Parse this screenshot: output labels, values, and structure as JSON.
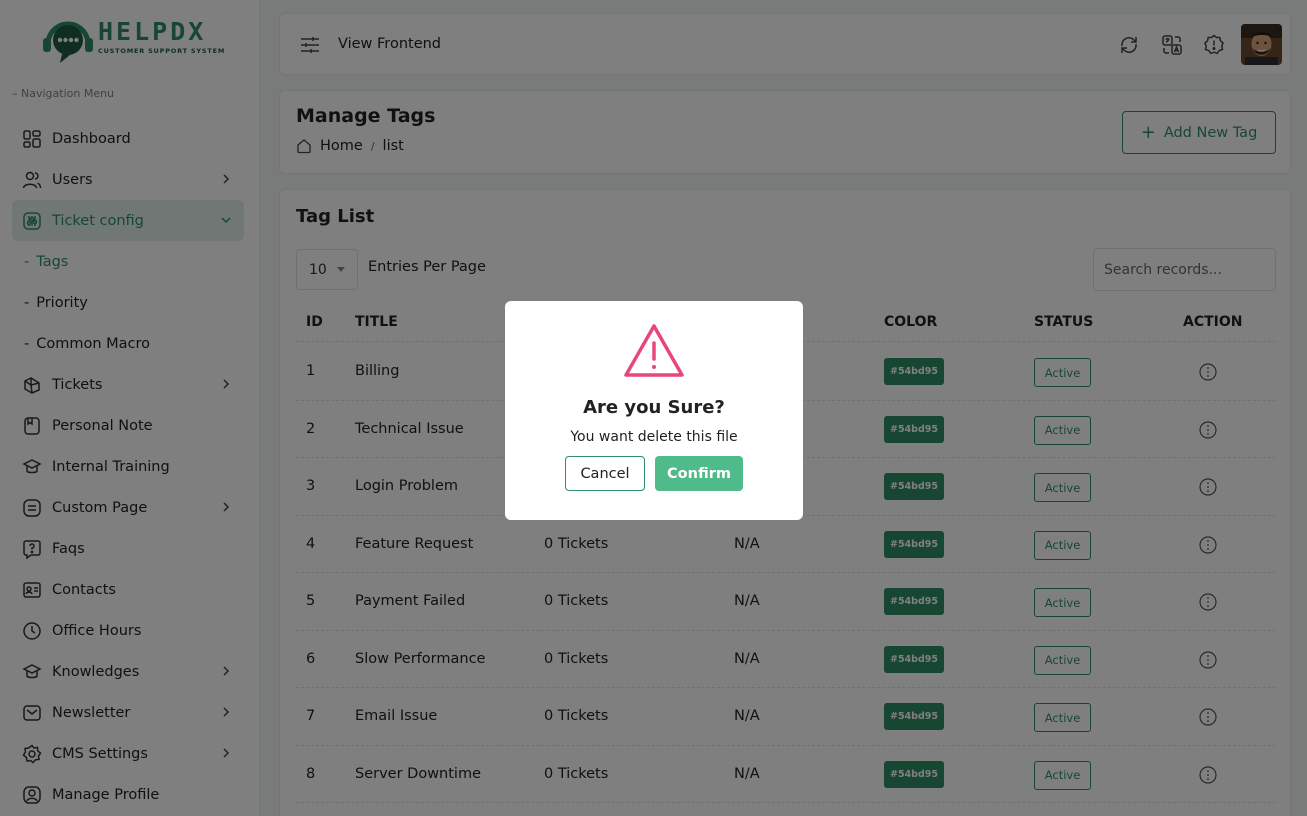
{
  "brand": {
    "name": "HELPDX",
    "tagline": "CUSTOMER SUPPORT SYSTEM",
    "color": "#2f8f66"
  },
  "sidebar": {
    "heading": "Navigation Menu",
    "items": [
      {
        "label": "Dashboard",
        "icon": "dashboard-icon"
      },
      {
        "label": "Users",
        "icon": "users-icon",
        "has_children": true
      },
      {
        "label": "Ticket config",
        "icon": "ticket-config-icon",
        "has_children": true,
        "active": true
      },
      {
        "label": "Tickets",
        "icon": "ticket-icon",
        "has_children": true
      },
      {
        "label": "Personal Note",
        "icon": "note-icon"
      },
      {
        "label": "Internal Training",
        "icon": "training-icon"
      },
      {
        "label": "Custom Page",
        "icon": "page-icon",
        "has_children": true
      },
      {
        "label": "Faqs",
        "icon": "faq-icon"
      },
      {
        "label": "Contacts",
        "icon": "contacts-icon"
      },
      {
        "label": "Office Hours",
        "icon": "clock-icon"
      },
      {
        "label": "Knowledges",
        "icon": "knowledge-icon",
        "has_children": true
      },
      {
        "label": "Newsletter",
        "icon": "newsletter-icon",
        "has_children": true
      },
      {
        "label": "CMS Settings",
        "icon": "settings-icon",
        "has_children": true
      },
      {
        "label": "Manage Profile",
        "icon": "profile-icon"
      }
    ],
    "ticket_config_children": [
      {
        "label": "Tags",
        "active": true
      },
      {
        "label": "Priority"
      },
      {
        "label": "Common Macro"
      }
    ]
  },
  "topbar": {
    "view_frontend": "View Frontend"
  },
  "page": {
    "title": "Manage Tags",
    "breadcrumb": {
      "home": "Home",
      "sep": "/",
      "current": "list"
    },
    "add_button": "Add New Tag"
  },
  "table": {
    "title": "Tag List",
    "entries_value": "10",
    "entries_label": "Entries Per Page",
    "search_placeholder": "Search records...",
    "columns": {
      "id": "ID",
      "title": "TITLE",
      "color": "COLOR",
      "status": "STATUS",
      "action": "ACTION"
    },
    "rows": [
      {
        "id": "1",
        "title": "Billing",
        "tickets": "",
        "parent": "",
        "color": "#54bd95",
        "status": "Active"
      },
      {
        "id": "2",
        "title": "Technical Issue",
        "tickets": "",
        "parent": "",
        "color": "#54bd95",
        "status": "Active"
      },
      {
        "id": "3",
        "title": "Login Problem",
        "tickets": "",
        "parent": "",
        "color": "#54bd95",
        "status": "Active"
      },
      {
        "id": "4",
        "title": "Feature Request",
        "tickets": "0 Tickets",
        "parent": "N/A",
        "color": "#54bd95",
        "status": "Active"
      },
      {
        "id": "5",
        "title": "Payment Failed",
        "tickets": "0 Tickets",
        "parent": "N/A",
        "color": "#54bd95",
        "status": "Active"
      },
      {
        "id": "6",
        "title": "Slow Performance",
        "tickets": "0 Tickets",
        "parent": "N/A",
        "color": "#54bd95",
        "status": "Active"
      },
      {
        "id": "7",
        "title": "Email Issue",
        "tickets": "0 Tickets",
        "parent": "N/A",
        "color": "#54bd95",
        "status": "Active"
      },
      {
        "id": "8",
        "title": "Server Downtime",
        "tickets": "0 Tickets",
        "parent": "N/A",
        "color": "#54bd95",
        "status": "Active"
      }
    ]
  },
  "modal": {
    "title": "Are you Sure?",
    "message": "You want delete this file",
    "cancel": "Cancel",
    "confirm": "Confirm",
    "warning_color": "#e8467c",
    "confirm_color": "#4fba8a"
  }
}
